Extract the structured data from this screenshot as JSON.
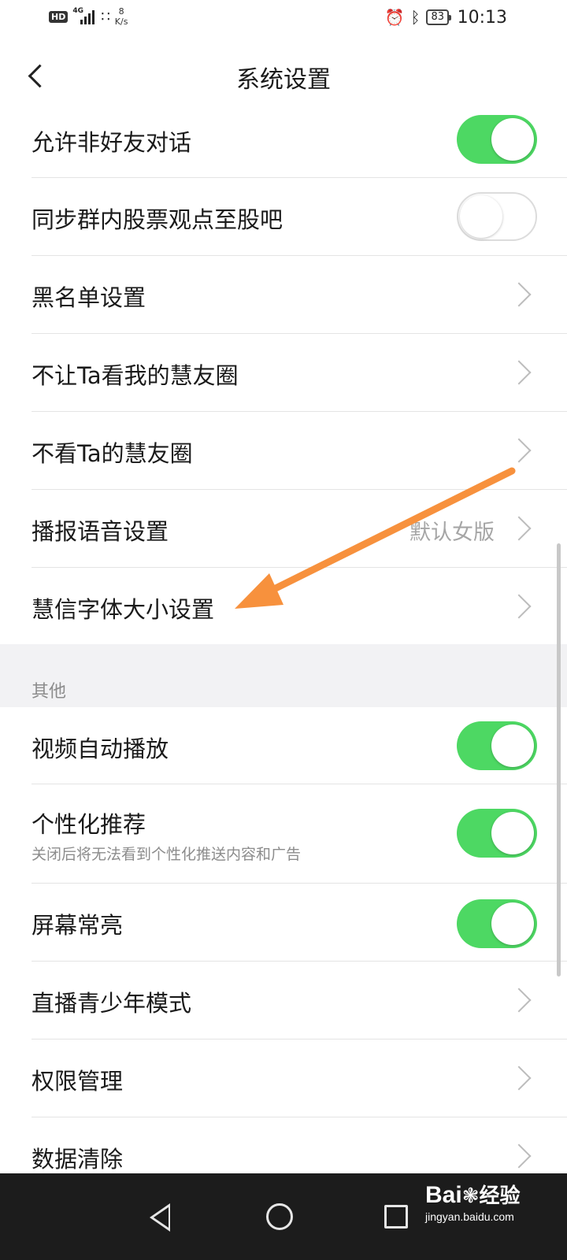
{
  "status_bar": {
    "hd": "HD",
    "network": "4G",
    "speed_value": "8",
    "speed_unit": "K/s",
    "battery": "83",
    "time": "10:13",
    "icons": [
      "signal-icon",
      "wifi-icon",
      "alarm-icon",
      "bluetooth-icon",
      "battery-icon"
    ]
  },
  "header": {
    "title": "系统设置"
  },
  "settings": {
    "allow_non_friend_chat": {
      "label": "允许非好友对话",
      "enabled": true
    },
    "sync_stock_views": {
      "label": "同步群内股票观点至股吧",
      "enabled": false
    },
    "blacklist": {
      "label": "黑名单设置"
    },
    "hide_moments_from": {
      "label": "不让Ta看我的慧友圈"
    },
    "dont_view_moments": {
      "label": "不看Ta的慧友圈"
    },
    "voice_broadcast": {
      "label": "播报语音设置",
      "value": "默认女版"
    },
    "font_size": {
      "label": "慧信字体大小设置"
    }
  },
  "other_section": {
    "title": "其他",
    "auto_play_video": {
      "label": "视频自动播放",
      "enabled": true
    },
    "personalized_recs": {
      "label": "个性化推荐",
      "sub": "关闭后将无法看到个性化推送内容和广告",
      "enabled": true
    },
    "screen_always_on": {
      "label": "屏幕常亮",
      "enabled": true
    },
    "youth_mode": {
      "label": "直播青少年模式"
    },
    "permissions": {
      "label": "权限管理"
    },
    "clear_data": {
      "label": "数据清除"
    }
  },
  "colors": {
    "toggle_on": "#4dd863",
    "annotation_arrow": "#f7913d",
    "section_bg": "#f2f2f4",
    "nav_bar": "#1c1c1c"
  },
  "watermark": {
    "brand_left": "Bai",
    "brand_right": "经验",
    "url": "jingyan.baidu.com"
  }
}
